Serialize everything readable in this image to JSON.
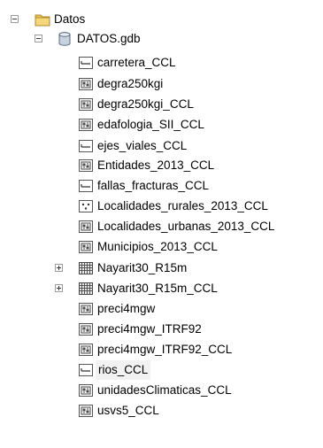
{
  "tree": {
    "root": {
      "label": "Datos",
      "icon": "folder-icon",
      "state": "expanded"
    },
    "database": {
      "label": "DATOS.gdb",
      "icon": "geodatabase-icon",
      "state": "expanded"
    },
    "items": [
      {
        "label": "carretera_CCL",
        "icon": "line-feature-class-icon"
      },
      {
        "label": "degra250kgi",
        "icon": "raster-icon"
      },
      {
        "label": "degra250kgi_CCL",
        "icon": "raster-icon"
      },
      {
        "label": "edafologia_SII_CCL",
        "icon": "raster-icon"
      },
      {
        "label": "ejes_viales_CCL",
        "icon": "line-feature-class-icon"
      },
      {
        "label": "Entidades_2013_CCL",
        "icon": "raster-icon"
      },
      {
        "label": "fallas_fracturas_CCL",
        "icon": "line-feature-class-icon"
      },
      {
        "label": "Localidades_rurales_2013_CCL",
        "icon": "point-feature-class-icon"
      },
      {
        "label": "Localidades_urbanas_2013_CCL",
        "icon": "raster-icon"
      },
      {
        "label": "Municipios_2013_CCL",
        "icon": "raster-icon"
      },
      {
        "label": "Nayarit30_R15m",
        "icon": "raster-dataset-icon",
        "state": "collapsed"
      },
      {
        "label": "Nayarit30_R15m_CCL",
        "icon": "raster-dataset-icon",
        "state": "collapsed"
      },
      {
        "label": "preci4mgw",
        "icon": "raster-icon"
      },
      {
        "label": "preci4mgw_ITRF92",
        "icon": "raster-icon"
      },
      {
        "label": "preci4mgw_ITRF92_CCL",
        "icon": "raster-icon"
      },
      {
        "label": "rios_CCL",
        "icon": "line-feature-class-icon",
        "selected": true
      },
      {
        "label": "unidadesClimaticas_CCL",
        "icon": "raster-icon"
      },
      {
        "label": "usvs5_CCL",
        "icon": "raster-icon"
      }
    ]
  }
}
